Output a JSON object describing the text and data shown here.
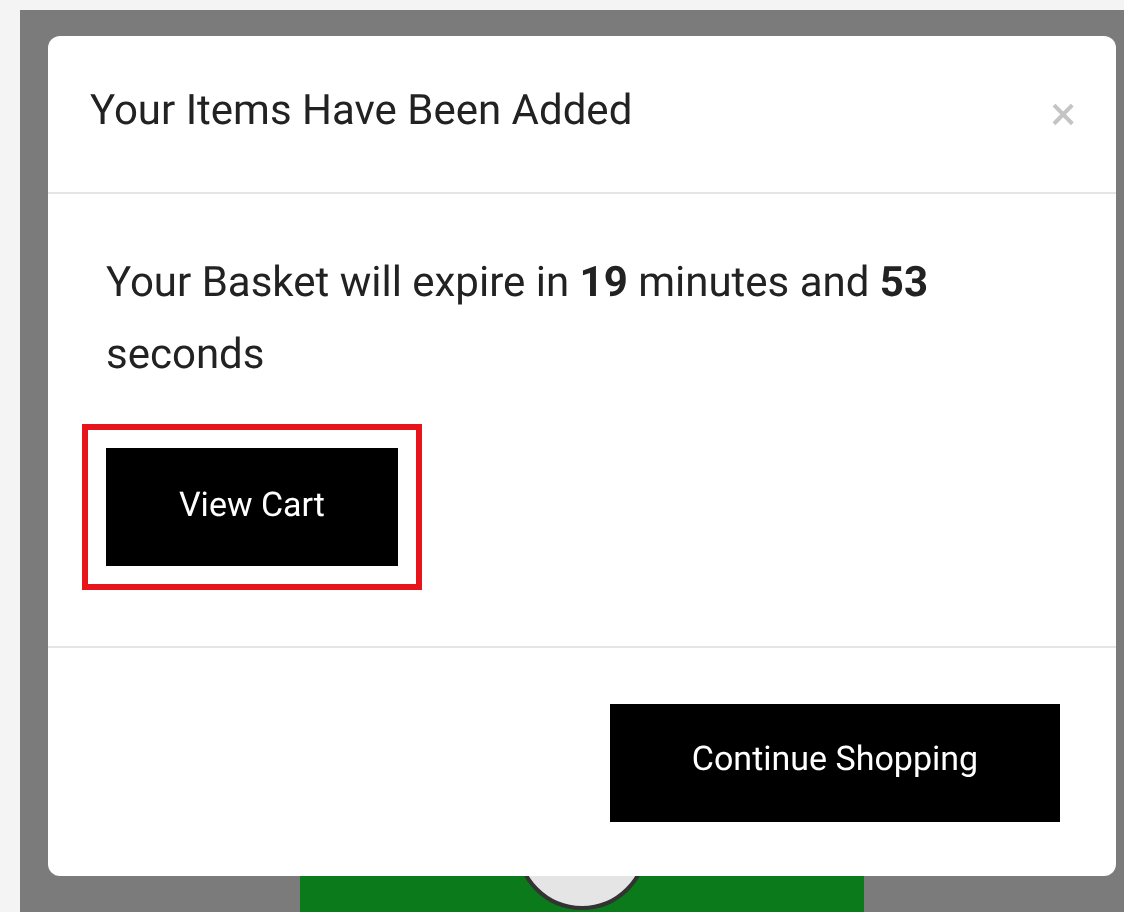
{
  "modal": {
    "title": "Your Items Have Been Added",
    "close": "×",
    "message": "Your Basket will expire in **19** minutes and **53** seconds",
    "view_cart": {
      "label": "View Cart",
      "highlighted": true
    },
    "continue": {
      "label": "Continue Shopping"
    }
  }
}
